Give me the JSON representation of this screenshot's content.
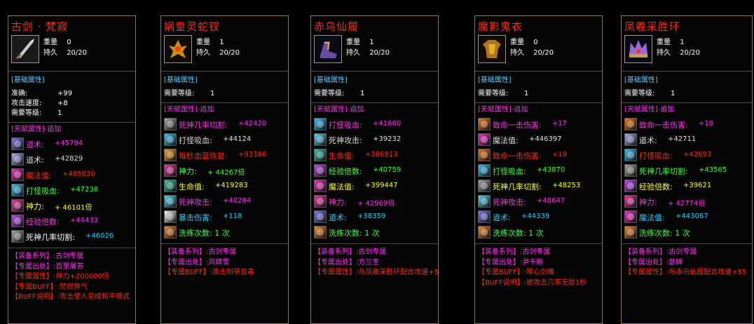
{
  "stat_labels": {
    "weight": "重量",
    "durability": "持久"
  },
  "section_basic": "[基础属性]",
  "section_talent": "[天赋属性]-追加",
  "items": [
    {
      "title": "古剑 · 梵寂",
      "weight": "0",
      "durability": "20/20",
      "icon": "sword-icon",
      "basic": [
        {
          "label": "准确:",
          "value": "+99"
        },
        {
          "label": "攻击速度:",
          "value": "+8"
        },
        {
          "label": "需要等级:",
          "value": "1"
        }
      ],
      "talents": [
        {
          "label": "道术:",
          "value": "+45794",
          "lc": "#ff33ee",
          "vc": "#ff33ee",
          "icon": "wing-icon",
          "ic": "#7a7aff"
        },
        {
          "label": "道术:",
          "value": "+42829",
          "lc": "#dddddd",
          "vc": "#dddddd",
          "icon": "wing-icon",
          "ic": "#b0b0ff"
        },
        {
          "label": "魔法值:",
          "value": "+485630",
          "lc": "#ff2a1a",
          "vc": "#ff2a1a",
          "icon": "orb-icon",
          "ic": "#ff2ad0"
        },
        {
          "label": "打怪吸血:",
          "value": "+47238",
          "lc": "#44ff44",
          "vc": "#44ff44",
          "icon": "drop-icon",
          "ic": "#33ccff"
        },
        {
          "label": "神力:",
          "value": "+ 46101倍",
          "lc": "#ffff33",
          "vc": "#ffff33",
          "icon": "star-icon",
          "ic": "#ff33aa"
        },
        {
          "label": "经验倍数:",
          "value": "+44433",
          "lc": "#ff33ee",
          "vc": "#ff33ee",
          "icon": "gem-icon",
          "ic": "#cc44ff"
        },
        {
          "label": "死神几率切割:",
          "value": "+46026",
          "lc": "#ffffff",
          "vc": "#33ccff",
          "icon": "blade-icon",
          "ic": "#aaaaaa"
        }
      ],
      "lines": [
        {
          "text": "【装备系列】:古剑专属",
          "color": "#ff33ee"
        },
        {
          "text": "【专属出处】:百里屠苏",
          "color": "#ff33ee"
        },
        {
          "text": "【专属属性】:神力+200000倍",
          "color": "#ff2a1a"
        },
        {
          "text": "【专属BUFF】:焚寂煞气",
          "color": "#ff2a1a"
        },
        {
          "text": "【BUFF说明】:攻击使人变成和平模式",
          "color": "#ff2a1a"
        }
      ]
    },
    {
      "title": "娲皇灵蛇钗",
      "weight": "1",
      "durability": "20/20",
      "icon": "hairpin-icon",
      "basic": [
        {
          "label": "需要等级:",
          "value": "1"
        }
      ],
      "talents": [
        {
          "label": "死神几率切割:",
          "value": "+42420",
          "lc": "#ff33ee",
          "vc": "#ff33ee",
          "icon": "blade-icon",
          "ic": "#aaaaaa"
        },
        {
          "label": "打怪吸血:",
          "value": "+44124",
          "lc": "#dddddd",
          "vc": "#dddddd",
          "icon": "drop-icon",
          "ic": "#33ccff"
        },
        {
          "label": "每秒血蓝恢复:",
          "value": "+93386",
          "lc": "#ff2a1a",
          "vc": "#ff2a1a",
          "icon": "fire-icon",
          "ic": "#ffaa22"
        },
        {
          "label": "神力:",
          "value": "+ 44267倍",
          "lc": "#44ff44",
          "vc": "#44ff44",
          "icon": "star-icon",
          "ic": "#ff33aa"
        },
        {
          "label": "生命值:",
          "value": "+419283",
          "lc": "#ffff33",
          "vc": "#ffff33",
          "icon": "leaf-icon",
          "ic": "#33ccaa"
        },
        {
          "label": "死神攻击:",
          "value": "+40284",
          "lc": "#ff33ee",
          "vc": "#ff33ee",
          "icon": "eye-icon",
          "ic": "#55ddff"
        },
        {
          "label": "暴击伤害:",
          "value": "+118",
          "lc": "#33ccff",
          "vc": "#33ccff",
          "icon": "burst-icon",
          "ic": "#ffffff"
        },
        {
          "label": "洗练次数: 1 次",
          "value": "",
          "lc": "#44ff44",
          "vc": "#44ff44",
          "icon": "rune-icon",
          "ic": "#ff8822"
        }
      ],
      "lines": [
        {
          "text": "【装备系列】:古剑专属",
          "color": "#ff33ee"
        },
        {
          "text": "【专属出处】:风晴雪",
          "color": "#ff33ee"
        },
        {
          "text": "【专属BUFF】:攻击附带双毒",
          "color": "#ff2a1a"
        }
      ]
    },
    {
      "title": "赤乌仙履",
      "weight": "1",
      "durability": "20/20",
      "icon": "boots-icon",
      "basic": [
        {
          "label": "需要等级:",
          "value": "1"
        }
      ],
      "talents": [
        {
          "label": "打怪吸血:",
          "value": "+41660",
          "lc": "#ff33ee",
          "vc": "#ff33ee",
          "icon": "drop-icon",
          "ic": "#33ccff"
        },
        {
          "label": "死神攻击:",
          "value": "+39232",
          "lc": "#dddddd",
          "vc": "#dddddd",
          "icon": "eye-icon",
          "ic": "#55ddff"
        },
        {
          "label": "生命值:",
          "value": "+386913",
          "lc": "#ff2a1a",
          "vc": "#ff2a1a",
          "icon": "leaf-icon",
          "ic": "#33ccaa"
        },
        {
          "label": "经验倍数:",
          "value": "+40759",
          "lc": "#44ff44",
          "vc": "#44ff44",
          "icon": "gem-icon",
          "ic": "#cc44ff"
        },
        {
          "label": "魔法值:",
          "value": "+399447",
          "lc": "#ffff33",
          "vc": "#ffff33",
          "icon": "orb-icon",
          "ic": "#ff2ad0"
        },
        {
          "label": "神力:",
          "value": "+ 42969倍",
          "lc": "#ff33ee",
          "vc": "#ff33ee",
          "icon": "star-icon",
          "ic": "#ff33aa"
        },
        {
          "label": "道术:",
          "value": "+38359",
          "lc": "#33ccff",
          "vc": "#33ccff",
          "icon": "wing-icon",
          "ic": "#7a7aff"
        },
        {
          "label": "洗练次数: 1 次",
          "value": "",
          "lc": "#44ff44",
          "vc": "#44ff44",
          "icon": "rune-icon",
          "ic": "#ff8822"
        }
      ],
      "lines": [
        {
          "text": "【装备系列】:古剑专属",
          "color": "#ff33ee"
        },
        {
          "text": "【专属出处】:方兰生",
          "color": "#ff33ee"
        },
        {
          "text": "【专属属性】:与凤羲采胜环配合攻速+55",
          "color": "#ff2a1a"
        }
      ]
    },
    {
      "title": "魔影鬼衣",
      "weight": "0",
      "durability": "20/20",
      "icon": "armor-icon",
      "basic": [
        {
          "label": "需要等级:",
          "value": "1"
        }
      ],
      "talents": [
        {
          "label": "致命一击伤害:",
          "value": "+17",
          "lc": "#ff33ee",
          "vc": "#ff33ee",
          "icon": "burst-icon",
          "ic": "#ff7711"
        },
        {
          "label": "魔法值:",
          "value": "+446397",
          "lc": "#dddddd",
          "vc": "#dddddd",
          "icon": "orb-icon",
          "ic": "#ff2ad0"
        },
        {
          "label": "致命一击伤害:",
          "value": "+19",
          "lc": "#ff2a1a",
          "vc": "#ff2a1a",
          "icon": "burst-icon",
          "ic": "#ff7711"
        },
        {
          "label": "打怪吸血:",
          "value": "+43870",
          "lc": "#44ff44",
          "vc": "#44ff44",
          "icon": "drop-icon",
          "ic": "#33ccff"
        },
        {
          "label": "死神几率切割:",
          "value": "+48253",
          "lc": "#ffff33",
          "vc": "#ffff33",
          "icon": "blade-icon",
          "ic": "#aaaaaa"
        },
        {
          "label": "死神攻击:",
          "value": "+48647",
          "lc": "#ff33ee",
          "vc": "#ff33ee",
          "icon": "eye-icon",
          "ic": "#55ddff"
        },
        {
          "label": "道术:",
          "value": "+44339",
          "lc": "#33ccff",
          "vc": "#33ccff",
          "icon": "wing-icon",
          "ic": "#7a7aff"
        },
        {
          "label": "洗练次数: 1 次",
          "value": "",
          "lc": "#44ff44",
          "vc": "#44ff44",
          "icon": "rune-icon",
          "ic": "#ff8822"
        }
      ],
      "lines": [
        {
          "text": "【装备系列】:古剑专属",
          "color": "#ff33ee"
        },
        {
          "text": "【专属出处】:尹千觞",
          "color": "#ff33ee"
        },
        {
          "text": "【专属BUFF】:琴心剑魄",
          "color": "#ff2a1a"
        },
        {
          "text": "【BUFF说明】:被攻击几率无敌1秒",
          "color": "#ff2a1a"
        }
      ]
    },
    {
      "title": "凤羲采胜环",
      "weight": "1",
      "durability": "20/20",
      "icon": "crown-icon",
      "basic": [
        {
          "label": "需要等级:",
          "value": "1"
        }
      ],
      "talents": [
        {
          "label": "致命一击伤害:",
          "value": "+18",
          "lc": "#ff33ee",
          "vc": "#ff33ee",
          "icon": "burst-icon",
          "ic": "#ff7711"
        },
        {
          "label": "道术:",
          "value": "+42711",
          "lc": "#dddddd",
          "vc": "#dddddd",
          "icon": "wing-icon",
          "ic": "#b0b0ff"
        },
        {
          "label": "打怪吸血:",
          "value": "+42693",
          "lc": "#ff2a1a",
          "vc": "#ff2a1a",
          "icon": "drop-icon",
          "ic": "#33ccff"
        },
        {
          "label": "死神几率切割:",
          "value": "+43565",
          "lc": "#44ff44",
          "vc": "#44ff44",
          "icon": "blade-icon",
          "ic": "#aaaaaa"
        },
        {
          "label": "经验倍数:",
          "value": "+39621",
          "lc": "#ffff33",
          "vc": "#ffff33",
          "icon": "gem-icon",
          "ic": "#cc44ff"
        },
        {
          "label": "神力:",
          "value": "+ 42774倍",
          "lc": "#ff33ee",
          "vc": "#ff33ee",
          "icon": "star-icon",
          "ic": "#ff33aa"
        },
        {
          "label": "魔法值:",
          "value": "+443067",
          "lc": "#33ccff",
          "vc": "#33ccff",
          "icon": "orb-icon",
          "ic": "#ff2ad0"
        },
        {
          "label": "洗练次数: 1 次",
          "value": "",
          "lc": "#44ff44",
          "vc": "#44ff44",
          "icon": "rune-icon",
          "ic": "#ff8822"
        }
      ],
      "lines": [
        {
          "text": "【装备系列】:古剑专属",
          "color": "#ff33ee"
        },
        {
          "text": "【专属出处】:瑟蝉",
          "color": "#ff33ee"
        },
        {
          "text": "【专属属性】:与赤乌仙履配合攻速+55",
          "color": "#ff2a1a"
        }
      ]
    }
  ]
}
